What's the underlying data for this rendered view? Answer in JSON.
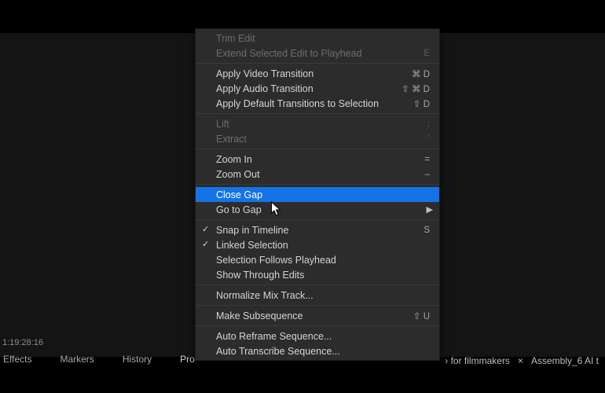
{
  "timecode": "1:19:28:16",
  "tabs": {
    "effects": "Effects",
    "markers": "Markers",
    "history": "History",
    "project": "Pro"
  },
  "right": {
    "snippet": "› for filmmakers",
    "close": "×",
    "seq": "Assembly_6 AI t"
  },
  "menu": {
    "trim": "Trim Edit",
    "extend": "Extend Selected Edit to Playhead",
    "extend_sc": "E",
    "applyVideo": "Apply Video Transition",
    "applyVideo_sc": "⌘ D",
    "applyAudio": "Apply Audio Transition",
    "applyAudio_sc": "⇧ ⌘ D",
    "applyDefault": "Apply Default Transitions to Selection",
    "applyDefault_sc": "⇧ D",
    "lift": "Lift",
    "lift_sc": ";",
    "extract": "Extract",
    "extract_sc": "'",
    "zoomIn": "Zoom In",
    "zoomIn_sc": "=",
    "zoomOut": "Zoom Out",
    "zoomOut_sc": "–",
    "closeGap": "Close Gap",
    "goToGap": "Go to Gap",
    "snap": "Snap in Timeline",
    "snap_sc": "S",
    "linked": "Linked Selection",
    "selFollow": "Selection Follows Playhead",
    "showThrough": "Show Through Edits",
    "normalize": "Normalize Mix Track...",
    "makeSub": "Make Subsequence",
    "makeSub_sc": "⇧ U",
    "autoReframe": "Auto Reframe Sequence...",
    "autoTrans": "Auto Transcribe Sequence..."
  }
}
